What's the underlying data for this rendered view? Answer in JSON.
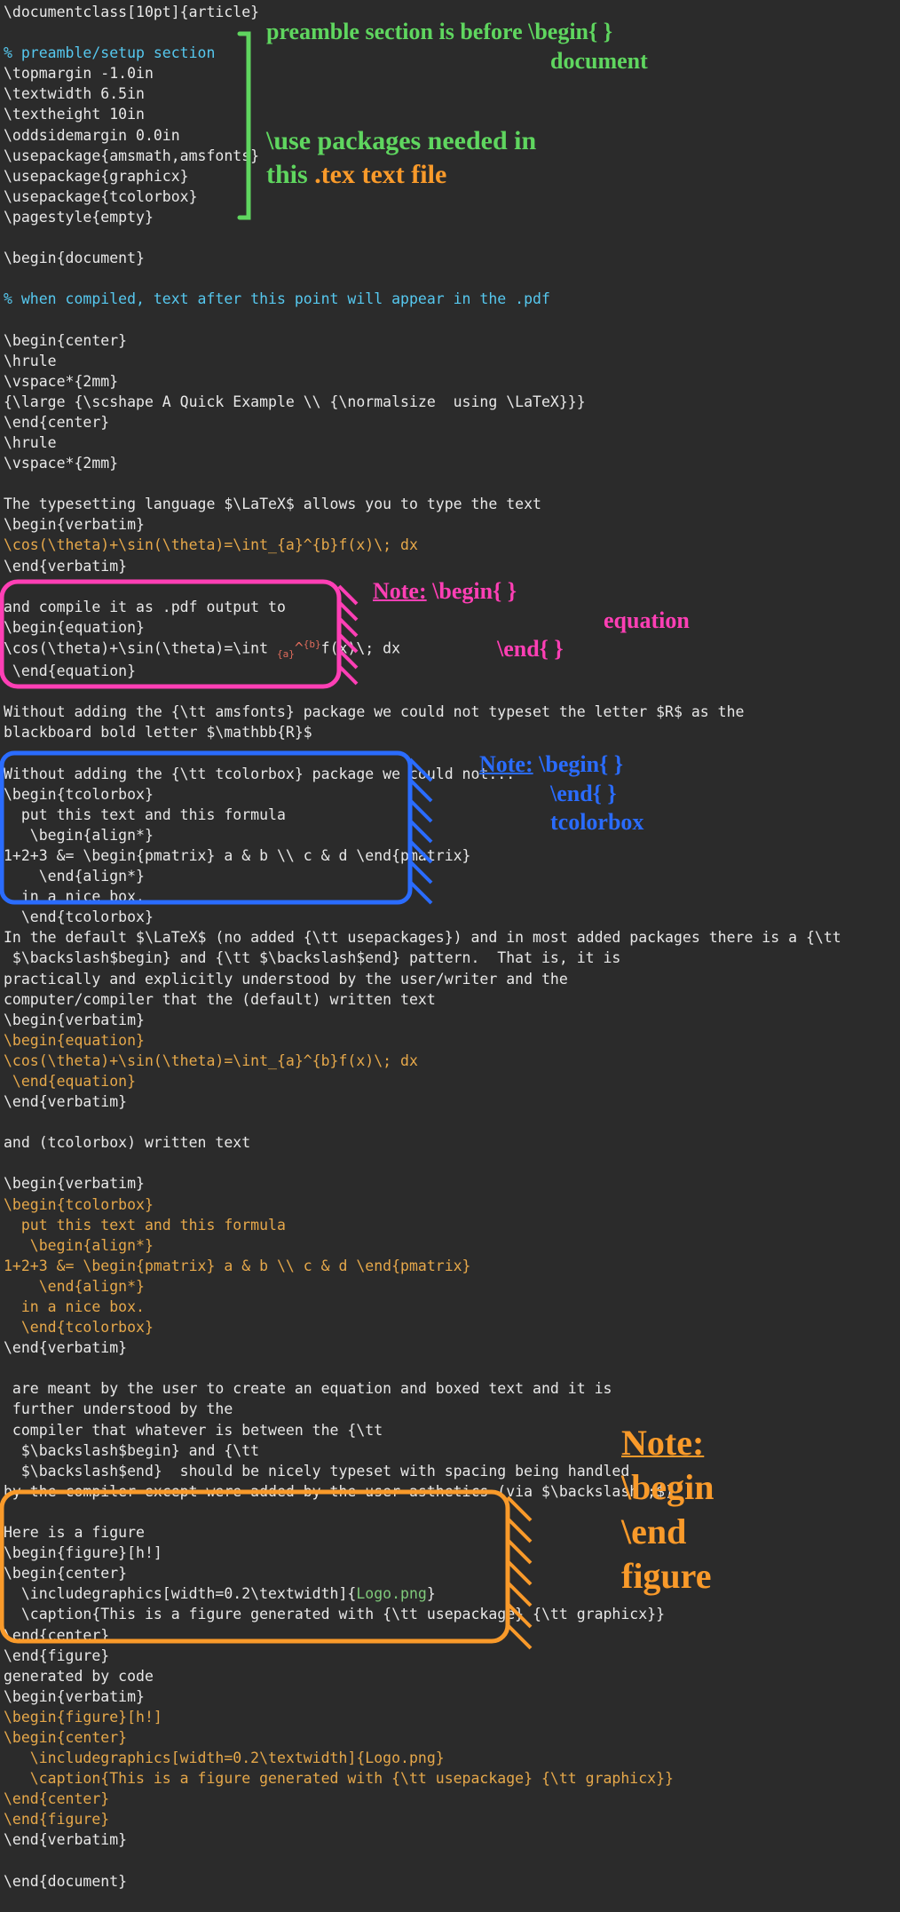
{
  "lines": [
    {
      "segs": [
        {
          "t": "\\documentclass[10pt]{article}",
          "c": "white"
        }
      ]
    },
    {
      "segs": [
        {
          "t": "",
          "c": "white"
        }
      ]
    },
    {
      "segs": [
        {
          "t": "% preamble/setup section",
          "c": "cyan"
        }
      ]
    },
    {
      "segs": [
        {
          "t": "\\topmargin -1.0in",
          "c": "white"
        }
      ]
    },
    {
      "segs": [
        {
          "t": "\\textwidth 6.5in",
          "c": "white"
        }
      ]
    },
    {
      "segs": [
        {
          "t": "\\textheight 10in",
          "c": "white"
        }
      ]
    },
    {
      "segs": [
        {
          "t": "\\oddsidemargin 0.0in",
          "c": "white"
        }
      ]
    },
    {
      "segs": [
        {
          "t": "\\usepackage{amsmath,amsfonts}",
          "c": "white"
        }
      ]
    },
    {
      "segs": [
        {
          "t": "\\usepackage{graphicx}",
          "c": "white"
        }
      ]
    },
    {
      "segs": [
        {
          "t": "\\usepackage{tcolorbox}",
          "c": "white"
        }
      ]
    },
    {
      "segs": [
        {
          "t": "\\pagestyle{empty}",
          "c": "white"
        }
      ]
    },
    {
      "segs": [
        {
          "t": "",
          "c": "white"
        }
      ]
    },
    {
      "segs": [
        {
          "t": "\\begin{document}",
          "c": "white"
        }
      ]
    },
    {
      "segs": [
        {
          "t": "",
          "c": "white"
        }
      ]
    },
    {
      "segs": [
        {
          "t": "% when compiled, text after this point will appear in the .pdf",
          "c": "cyan"
        }
      ]
    },
    {
      "segs": [
        {
          "t": "",
          "c": "white"
        }
      ]
    },
    {
      "segs": [
        {
          "t": "\\begin{center}",
          "c": "white"
        }
      ]
    },
    {
      "segs": [
        {
          "t": "\\hrule",
          "c": "white"
        }
      ]
    },
    {
      "segs": [
        {
          "t": "\\vspace*{2mm}",
          "c": "white"
        }
      ]
    },
    {
      "segs": [
        {
          "t": "{\\large {\\scshape A Quick Example \\\\ {\\normalsize  using \\LaTeX}}}",
          "c": "white"
        }
      ]
    },
    {
      "segs": [
        {
          "t": "\\end{center}",
          "c": "white"
        }
      ]
    },
    {
      "segs": [
        {
          "t": "\\hrule",
          "c": "white"
        }
      ]
    },
    {
      "segs": [
        {
          "t": "\\vspace*{2mm}",
          "c": "white"
        }
      ]
    },
    {
      "segs": [
        {
          "t": "",
          "c": "white"
        }
      ]
    },
    {
      "segs": [
        {
          "t": "The typesetting language $\\LaTeX$ allows you to type the text",
          "c": "white"
        }
      ]
    },
    {
      "segs": [
        {
          "t": "\\begin{verbatim}",
          "c": "white"
        }
      ]
    },
    {
      "segs": [
        {
          "t": "\\cos(\\theta)+\\sin(\\theta)=\\int_{a}^{b}f(x)\\; dx",
          "c": "orange"
        }
      ]
    },
    {
      "segs": [
        {
          "t": "\\end{verbatim}",
          "c": "white"
        }
      ]
    },
    {
      "segs": [
        {
          "t": "",
          "c": "white"
        }
      ]
    },
    {
      "segs": [
        {
          "t": "and compile it as .pdf output to",
          "c": "white"
        }
      ]
    },
    {
      "segs": [
        {
          "t": "\\begin{equation}",
          "c": "white"
        }
      ]
    },
    {
      "segs": [
        {
          "t": "\\cos(\\theta)+\\sin(\\theta)=\\int ",
          "c": "white"
        },
        {
          "t": "{a}",
          "c": "sub"
        },
        {
          "t": "^",
          "c": "red"
        },
        {
          "t": "{b}",
          "c": "sup"
        },
        {
          "t": "f(x)\\; dx",
          "c": "white"
        }
      ]
    },
    {
      "segs": [
        {
          "t": " \\end{equation}",
          "c": "white"
        }
      ]
    },
    {
      "segs": [
        {
          "t": "",
          "c": "white"
        }
      ]
    },
    {
      "segs": [
        {
          "t": "Without adding the {\\tt amsfonts} package we could not typeset the letter $R$ as the",
          "c": "white"
        }
      ]
    },
    {
      "segs": [
        {
          "t": "blackboard bold letter $\\mathbb{R}$",
          "c": "white"
        }
      ]
    },
    {
      "segs": [
        {
          "t": "",
          "c": "white"
        }
      ]
    },
    {
      "segs": [
        {
          "t": "Without adding the {\\tt tcolorbox} package we could not...",
          "c": "white"
        }
      ]
    },
    {
      "segs": [
        {
          "t": "\\begin{tcolorbox}",
          "c": "white"
        }
      ]
    },
    {
      "segs": [
        {
          "t": "  put this text and this formula",
          "c": "white"
        }
      ]
    },
    {
      "segs": [
        {
          "t": "   \\begin{align*}",
          "c": "white"
        }
      ]
    },
    {
      "segs": [
        {
          "t": "1+2+3 &= \\begin{pmatrix} a & b \\\\ c & d \\end{pmatrix}",
          "c": "white"
        }
      ]
    },
    {
      "segs": [
        {
          "t": "    \\end{align*}",
          "c": "white"
        }
      ]
    },
    {
      "segs": [
        {
          "t": "  in a nice box.",
          "c": "white"
        }
      ]
    },
    {
      "segs": [
        {
          "t": "  \\end{tcolorbox}",
          "c": "white"
        }
      ]
    },
    {
      "segs": [
        {
          "t": "In the default $\\LaTeX$ (no added {\\tt usepackages}) and in most added packages there is a {\\tt",
          "c": "white"
        }
      ]
    },
    {
      "segs": [
        {
          "t": " $\\backslash$begin} and {\\tt $\\backslash$end} pattern.  That is, it is",
          "c": "white"
        }
      ]
    },
    {
      "segs": [
        {
          "t": "practically and explicitly understood by the user/writer and the",
          "c": "white"
        }
      ]
    },
    {
      "segs": [
        {
          "t": "computer/compiler that the (default) written text",
          "c": "white"
        }
      ]
    },
    {
      "segs": [
        {
          "t": "\\begin{verbatim}",
          "c": "white"
        }
      ]
    },
    {
      "segs": [
        {
          "t": "\\begin{equation}",
          "c": "orange"
        }
      ]
    },
    {
      "segs": [
        {
          "t": "\\cos(\\theta)+\\sin(\\theta)=\\int_{a}^{b}f(x)\\; dx",
          "c": "orange"
        }
      ]
    },
    {
      "segs": [
        {
          "t": " \\end{equation}",
          "c": "orange"
        }
      ]
    },
    {
      "segs": [
        {
          "t": "\\end{verbatim}",
          "c": "white"
        }
      ]
    },
    {
      "segs": [
        {
          "t": "",
          "c": "white"
        }
      ]
    },
    {
      "segs": [
        {
          "t": "and (tcolorbox) written text",
          "c": "white"
        }
      ]
    },
    {
      "segs": [
        {
          "t": "",
          "c": "white"
        }
      ]
    },
    {
      "segs": [
        {
          "t": "\\begin{verbatim}",
          "c": "white"
        }
      ]
    },
    {
      "segs": [
        {
          "t": "\\begin{tcolorbox}",
          "c": "orange"
        }
      ]
    },
    {
      "segs": [
        {
          "t": "  put this text and this formula",
          "c": "orange"
        }
      ]
    },
    {
      "segs": [
        {
          "t": "   \\begin{align*}",
          "c": "orange"
        }
      ]
    },
    {
      "segs": [
        {
          "t": "1+2+3 &= \\begin{pmatrix} a & b \\\\ c & d \\end{pmatrix}",
          "c": "orange"
        }
      ]
    },
    {
      "segs": [
        {
          "t": "    \\end{align*}",
          "c": "orange"
        }
      ]
    },
    {
      "segs": [
        {
          "t": "  in a nice box.",
          "c": "orange"
        }
      ]
    },
    {
      "segs": [
        {
          "t": "  \\end{tcolorbox}",
          "c": "orange"
        }
      ]
    },
    {
      "segs": [
        {
          "t": "\\end{verbatim}",
          "c": "white"
        }
      ]
    },
    {
      "segs": [
        {
          "t": "",
          "c": "white"
        }
      ]
    },
    {
      "segs": [
        {
          "t": " are meant by the user to create an equation and boxed text and it is",
          "c": "white"
        }
      ]
    },
    {
      "segs": [
        {
          "t": " further understood by the",
          "c": "white"
        }
      ]
    },
    {
      "segs": [
        {
          "t": " compiler that whatever is between the {\\tt",
          "c": "white"
        }
      ]
    },
    {
      "segs": [
        {
          "t": "  $\\backslash$begin} and {\\tt",
          "c": "white"
        }
      ]
    },
    {
      "segs": [
        {
          "t": "  $\\backslash$end}  should be nicely typeset with spacing being handled",
          "c": "white"
        }
      ]
    },
    {
      "segs": [
        {
          "t": "by the compiler except were added by the user asthetics (via $\\backslash ;$)",
          "c": "white"
        }
      ]
    },
    {
      "segs": [
        {
          "t": "",
          "c": "white"
        }
      ]
    },
    {
      "segs": [
        {
          "t": "Here is a figure",
          "c": "white"
        }
      ]
    },
    {
      "segs": [
        {
          "t": "\\begin{figure}[h!]",
          "c": "white"
        }
      ]
    },
    {
      "segs": [
        {
          "t": "\\begin{center}",
          "c": "white"
        }
      ]
    },
    {
      "segs": [
        {
          "t": "  \\includegraphics[width=0.2\\textwidth]{",
          "c": "white"
        },
        {
          "t": "Logo.png",
          "c": "green2"
        },
        {
          "t": "}",
          "c": "white"
        }
      ]
    },
    {
      "segs": [
        {
          "t": "  \\caption{This is a figure generated with {\\tt usepackage} {\\tt graphicx}}",
          "c": "white"
        }
      ]
    },
    {
      "segs": [
        {
          "t": "\\end{center}",
          "c": "white"
        }
      ]
    },
    {
      "segs": [
        {
          "t": "\\end{figure}",
          "c": "white"
        }
      ]
    },
    {
      "segs": [
        {
          "t": "generated by code",
          "c": "white"
        }
      ]
    },
    {
      "segs": [
        {
          "t": "\\begin{verbatim}",
          "c": "white"
        }
      ]
    },
    {
      "segs": [
        {
          "t": "\\begin{figure}[h!]",
          "c": "orange"
        }
      ]
    },
    {
      "segs": [
        {
          "t": "\\begin{center}",
          "c": "orange"
        }
      ]
    },
    {
      "segs": [
        {
          "t": "   \\includegraphics[width=0.2\\textwidth]{Logo.png}",
          "c": "orange"
        }
      ]
    },
    {
      "segs": [
        {
          "t": "   \\caption{This is a figure generated with {\\tt usepackage} {\\tt graphicx}}",
          "c": "orange"
        }
      ]
    },
    {
      "segs": [
        {
          "t": "\\end{center}",
          "c": "orange"
        }
      ]
    },
    {
      "segs": [
        {
          "t": "\\end{figure}",
          "c": "orange"
        }
      ]
    },
    {
      "segs": [
        {
          "t": "\\end{verbatim}",
          "c": "white"
        }
      ]
    },
    {
      "segs": [
        {
          "t": "",
          "c": "white"
        }
      ]
    },
    {
      "segs": [
        {
          "t": "\\end{document}",
          "c": "white"
        }
      ]
    }
  ],
  "annotations": {
    "a1_l1": "preamble section is before \\begin{ }",
    "a1_l2": "document",
    "a2_l1": "\\use packages needed in",
    "a2_l2": "this ",
    "a2_l3": ".tex text file",
    "a3_note": "Note:",
    "a3_l1": " \\begin{ }",
    "a3_l2": "equation",
    "a3_l3": "\\end{ }",
    "a4_note": "Note:",
    "a4_l1": " \\begin{ }",
    "a4_l2": "\\end{ }",
    "a4_l3": "tcolorbox",
    "a5_note": "Note:",
    "a5_l1": "\\begin",
    "a5_l2": "\\end",
    "a5_l3": "figure"
  },
  "colors": {
    "pink": "#ff3fb5",
    "blue": "#2a6cff",
    "orange": "#f99a2a",
    "green": "#5fd65f"
  }
}
